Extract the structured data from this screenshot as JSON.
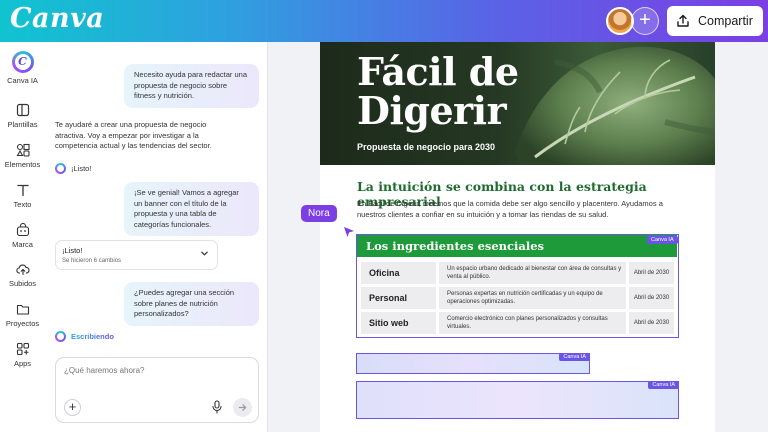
{
  "app": {
    "logo": "Canva",
    "share_label": "Compartir"
  },
  "rail": {
    "canva_ia": "Canva IA",
    "items": [
      {
        "label": "Plantillas",
        "icon": "templates-icon"
      },
      {
        "label": "Elementos",
        "icon": "elements-icon"
      },
      {
        "label": "Texto",
        "icon": "text-icon"
      },
      {
        "label": "Marca",
        "icon": "brand-icon"
      },
      {
        "label": "Subidos",
        "icon": "uploads-icon"
      },
      {
        "label": "Proyectos",
        "icon": "projects-icon"
      },
      {
        "label": "Apps",
        "icon": "apps-icon"
      }
    ]
  },
  "chat": {
    "user_msg_1": "Necesito ayuda para redactar una propuesta de negocio sobre fitness y nutrición.",
    "ai_msg_1": "Te ayudaré a crear una propuesta de negocio atractiva. Voy a empezar por investigar a la competencia actual y las tendencias del sector.",
    "ai_done_1": "¡Listo!",
    "user_msg_2": "¡Se ve genial! Vamos a agregar un banner con el título de la propuesta y una tabla de categorías funcionales.",
    "status_title": "¡Listo!",
    "status_sub": "Se hicieron 6 cambios",
    "user_msg_3": "¿Puedes agregar una sección sobre planes de nutrición personalizados?",
    "writing": "Escribiendo",
    "composer_placeholder": "¿Qué haremos ahora?"
  },
  "doc": {
    "hero_title_line1": "Fácil de",
    "hero_title_line2": "Digerir",
    "hero_subtitle": "Propuesta de negocio para 2030",
    "section_title": "La intuición se combina con la estrategia empresarial",
    "body": "En Fácil de Digerir, creemos que la comida debe ser algo sencillo y placentero. Ayudamos a nuestros clientes a confiar en su intuición y a tomar las riendas de su salud.",
    "table_title": "Los ingredientes esenciales",
    "ia_tag": "Canva IA",
    "rows": [
      {
        "name": "Oficina",
        "desc": "Un espacio urbano dedicado al bienestar con área de consultas y venta al público.",
        "date": "Abril de 2030"
      },
      {
        "name": "Personal",
        "desc": "Personas expertas en nutrición certificadas y un equipo de operaciones optimizadas.",
        "date": "Abril de 2030"
      },
      {
        "name": "Sitio web",
        "desc": "Comercio electrónico con planes personalizados y consultas virtuales.",
        "date": "Abril de 2030"
      }
    ]
  },
  "collaborator": {
    "name": "Nora",
    "color": "#7b3fe4"
  },
  "colors": {
    "brand_green": "#1f9a3b",
    "ia_purple": "#6a56e6"
  }
}
